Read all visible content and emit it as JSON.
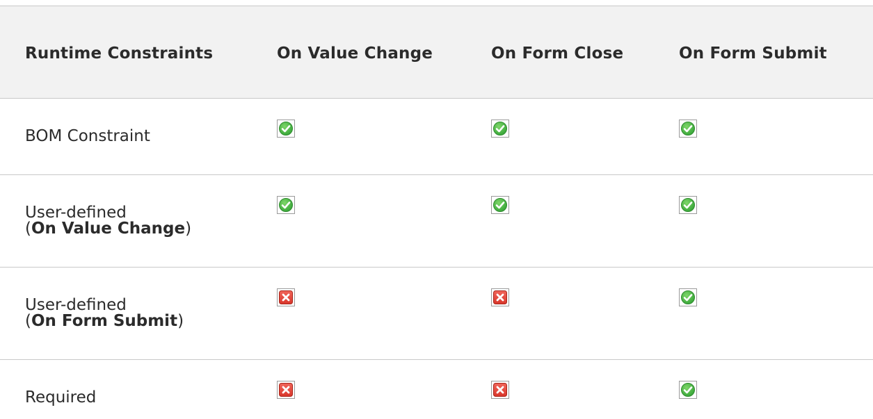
{
  "table": {
    "headers": [
      "Runtime Constraints",
      "On Value Change",
      "On Form Close",
      "On Form Submit"
    ],
    "rows": [
      {
        "label": "BOM Constraint",
        "label_line2_prefix": "",
        "label_line2_bold": "",
        "label_line2_suffix": "",
        "status": [
          "check-icon",
          "check-icon",
          "check-icon"
        ]
      },
      {
        "label": "User-defined",
        "label_line2_prefix": "(",
        "label_line2_bold": "On Value Change",
        "label_line2_suffix": ")",
        "status": [
          "check-icon",
          "check-icon",
          "check-icon"
        ]
      },
      {
        "label": "User-defined",
        "label_line2_prefix": "(",
        "label_line2_bold": "On Form Submit",
        "label_line2_suffix": ")",
        "status": [
          "cross-icon",
          "cross-icon",
          "check-icon"
        ]
      },
      {
        "label": "Required",
        "label_line2_prefix": "",
        "label_line2_bold": "",
        "label_line2_suffix": "",
        "status": [
          "cross-icon",
          "cross-icon",
          "check-icon"
        ]
      }
    ]
  },
  "colors": {
    "check": "#3aa83a",
    "cross": "#d9362b",
    "header_bg": "#f2f2f2",
    "rule": "#c8c8c8"
  }
}
